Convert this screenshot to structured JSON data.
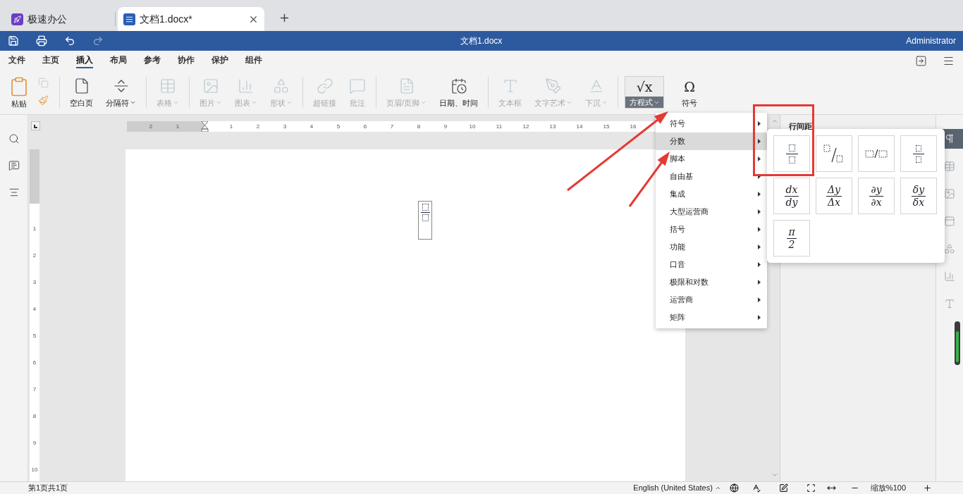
{
  "tabs": [
    {
      "label": "极速办公",
      "selected": false
    },
    {
      "label": "文档1.docx*",
      "selected": true
    }
  ],
  "title_bar": {
    "quick_access": [
      {
        "disabled": false
      },
      {
        "disabled": false
      },
      {
        "disabled": false
      },
      {
        "disabled": true
      }
    ],
    "title": "文档1.docx",
    "user": "Administrator"
  },
  "menu_tabs": [
    {
      "label": "文件",
      "selected": false
    },
    {
      "label": "主页",
      "selected": false
    },
    {
      "label": "插入",
      "selected": true
    },
    {
      "label": "布局",
      "selected": false
    },
    {
      "label": "参考",
      "selected": false
    },
    {
      "label": "协作",
      "selected": false
    },
    {
      "label": "保护",
      "selected": false
    },
    {
      "label": "组件",
      "selected": false
    }
  ],
  "ribbon": {
    "groups": [
      [
        {
          "kind": "paste",
          "label": "粘贴",
          "disabled": false,
          "small_tools": [
            {
              "disabled": true
            },
            {
              "disabled": false
            }
          ]
        }
      ],
      [
        {
          "kind": "button",
          "label": "空白页",
          "disabled": false,
          "dropdown": false
        },
        {
          "kind": "button",
          "label": "分隔符",
          "disabled": false,
          "dropdown": true
        }
      ],
      [
        {
          "kind": "button",
          "label": "表格",
          "disabled": true,
          "dropdown": true
        }
      ],
      [
        {
          "kind": "button",
          "label": "图片",
          "disabled": true,
          "dropdown": true
        },
        {
          "kind": "button",
          "label": "图表",
          "disabled": true,
          "dropdown": true
        },
        {
          "kind": "button",
          "label": "形状",
          "disabled": true,
          "dropdown": true
        }
      ],
      [
        {
          "kind": "button",
          "label": "超链接",
          "disabled": true,
          "dropdown": false
        },
        {
          "kind": "button",
          "label": "批注",
          "disabled": true,
          "dropdown": false
        }
      ],
      [
        {
          "kind": "button",
          "label": "页眉/页脚",
          "disabled": true,
          "dropdown": true
        },
        {
          "kind": "button",
          "label": "日期、时间",
          "disabled": false,
          "dropdown": false
        }
      ],
      [
        {
          "kind": "button",
          "label": "文本框",
          "disabled": true,
          "dropdown": false
        },
        {
          "kind": "button",
          "label": "文字艺术",
          "disabled": true,
          "dropdown": true
        },
        {
          "kind": "button",
          "label": "下沉",
          "disabled": true,
          "dropdown": true
        }
      ],
      [
        {
          "kind": "glyph",
          "label": "方程式",
          "symbol": "√x",
          "disabled": false,
          "dropdown": true,
          "expanded": true
        },
        {
          "kind": "glyph",
          "label": "符号",
          "symbol": "Ω",
          "disabled": false,
          "dropdown": false,
          "expanded": false
        }
      ]
    ]
  },
  "ruler": {
    "horizontal_before": [
      "2",
      "1"
    ],
    "horizontal_after": [
      "1",
      "2",
      "3",
      "4",
      "5",
      "6",
      "7",
      "8",
      "9",
      "10",
      "11",
      "12",
      "13",
      "14",
      "15",
      "16"
    ],
    "vertical": [
      "1",
      "2",
      "3",
      "4",
      "5",
      "6",
      "7",
      "8",
      "9",
      "10"
    ]
  },
  "equation_menu": {
    "items": [
      {
        "label": "符号",
        "selected": false
      },
      {
        "label": "分数",
        "selected": true
      },
      {
        "label": "脚本",
        "selected": false
      },
      {
        "label": "自由基",
        "selected": false
      },
      {
        "label": "集成",
        "selected": false
      },
      {
        "label": "大型运营商",
        "selected": false
      },
      {
        "label": "括号",
        "selected": false
      },
      {
        "label": "功能",
        "selected": false
      },
      {
        "label": "口音",
        "selected": false
      },
      {
        "label": "极限和对数",
        "selected": false
      },
      {
        "label": "运营商",
        "selected": false
      },
      {
        "label": "矩阵",
        "selected": false
      }
    ]
  },
  "fraction_gallery": {
    "items": [
      {
        "kind": "stacked_empty"
      },
      {
        "kind": "skewed_empty"
      },
      {
        "kind": "linear_empty"
      },
      {
        "kind": "small_stacked_empty"
      },
      {
        "kind": "stacked",
        "numerator": "dx",
        "denominator": "dy"
      },
      {
        "kind": "stacked",
        "numerator": "Δy",
        "denominator": "Δx"
      },
      {
        "kind": "stacked",
        "numerator": "∂y",
        "denominator": "∂x"
      },
      {
        "kind": "stacked",
        "numerator": "δy",
        "denominator": "δx"
      },
      {
        "kind": "stacked",
        "numerator": "π",
        "denominator": "2"
      }
    ]
  },
  "right_panel": {
    "heading": "行间距"
  },
  "side_tools": [
    {
      "selected": true
    },
    {
      "selected": false
    },
    {
      "selected": false
    },
    {
      "selected": false
    },
    {
      "selected": false
    },
    {
      "selected": false
    },
    {
      "selected": false
    }
  ],
  "status_bar": {
    "page": "第1页共1页",
    "language": "English (United States)",
    "zoom": "缩放%100"
  }
}
